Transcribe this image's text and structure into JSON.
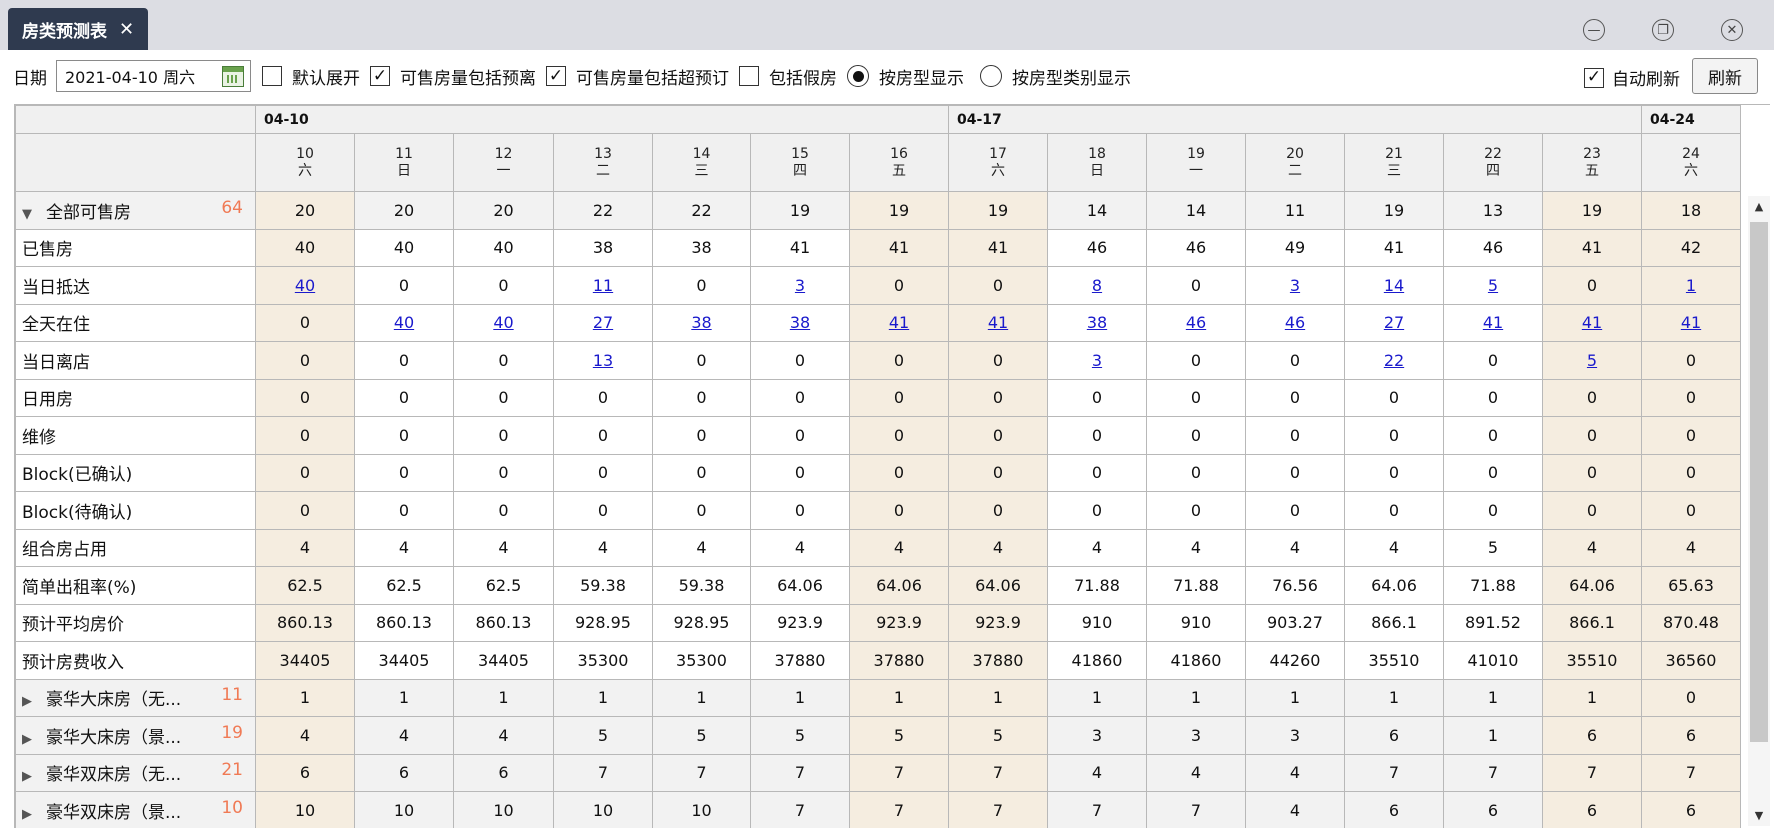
{
  "window": {
    "tab_title": "房类预测表"
  },
  "toolbar": {
    "date_label": "日期",
    "date_value": "2021-04-10 周六",
    "opt_expand": "默认展开",
    "opt_include_preblock": "可售房量包括预离",
    "opt_include_overbook": "可售房量包括超预订",
    "opt_include_fake": "包括假房",
    "radio_by_type": "按房型显示",
    "radio_by_category": "按房型类别显示",
    "auto_refresh": "自动刷新",
    "refresh": "刷新"
  },
  "grid": {
    "week_labels": [
      "04-10",
      "04-17",
      "04-24"
    ],
    "days": [
      {
        "d": "10",
        "w": "六"
      },
      {
        "d": "11",
        "w": "日"
      },
      {
        "d": "12",
        "w": "一"
      },
      {
        "d": "13",
        "w": "二"
      },
      {
        "d": "14",
        "w": "三"
      },
      {
        "d": "15",
        "w": "四"
      },
      {
        "d": "16",
        "w": "五"
      },
      {
        "d": "17",
        "w": "六"
      },
      {
        "d": "18",
        "w": "日"
      },
      {
        "d": "19",
        "w": "一"
      },
      {
        "d": "20",
        "w": "二"
      },
      {
        "d": "21",
        "w": "三"
      },
      {
        "d": "22",
        "w": "四"
      },
      {
        "d": "23",
        "w": "五"
      },
      {
        "d": "24",
        "w": "六"
      }
    ],
    "rows": [
      {
        "name": "全部可售房",
        "count": "64",
        "group": "expanded",
        "values": [
          "20",
          "20",
          "20",
          "22",
          "22",
          "19",
          "19",
          "19",
          "14",
          "14",
          "11",
          "19",
          "13",
          "19",
          "18"
        ]
      },
      {
        "name": "已售房",
        "values": [
          "40",
          "40",
          "40",
          "38",
          "38",
          "41",
          "41",
          "41",
          "46",
          "46",
          "49",
          "41",
          "46",
          "41",
          "42"
        ]
      },
      {
        "name": "当日抵达",
        "links": [
          0,
          3,
          5,
          8,
          10,
          11,
          12,
          14
        ],
        "values": [
          "40",
          "0",
          "0",
          "11",
          "0",
          "3",
          "0",
          "0",
          "8",
          "0",
          "3",
          "14",
          "5",
          "0",
          "1"
        ]
      },
      {
        "name": "全天在住",
        "links": [
          1,
          2,
          3,
          4,
          5,
          6,
          7,
          8,
          9,
          10,
          11,
          12,
          13,
          14
        ],
        "values": [
          "0",
          "40",
          "40",
          "27",
          "38",
          "38",
          "41",
          "41",
          "38",
          "46",
          "46",
          "27",
          "41",
          "41",
          "41"
        ]
      },
      {
        "name": "当日离店",
        "links": [
          3,
          8,
          11,
          13
        ],
        "values": [
          "0",
          "0",
          "0",
          "13",
          "0",
          "0",
          "0",
          "0",
          "3",
          "0",
          "0",
          "22",
          "0",
          "5",
          "0"
        ]
      },
      {
        "name": "日用房",
        "values": [
          "0",
          "0",
          "0",
          "0",
          "0",
          "0",
          "0",
          "0",
          "0",
          "0",
          "0",
          "0",
          "0",
          "0",
          "0"
        ]
      },
      {
        "name": "维修",
        "values": [
          "0",
          "0",
          "0",
          "0",
          "0",
          "0",
          "0",
          "0",
          "0",
          "0",
          "0",
          "0",
          "0",
          "0",
          "0"
        ]
      },
      {
        "name": "Block(已确认)",
        "values": [
          "0",
          "0",
          "0",
          "0",
          "0",
          "0",
          "0",
          "0",
          "0",
          "0",
          "0",
          "0",
          "0",
          "0",
          "0"
        ]
      },
      {
        "name": "Block(待确认)",
        "values": [
          "0",
          "0",
          "0",
          "0",
          "0",
          "0",
          "0",
          "0",
          "0",
          "0",
          "0",
          "0",
          "0",
          "0",
          "0"
        ]
      },
      {
        "name": "组合房占用",
        "values": [
          "4",
          "4",
          "4",
          "4",
          "4",
          "4",
          "4",
          "4",
          "4",
          "4",
          "4",
          "4",
          "5",
          "4",
          "4"
        ]
      },
      {
        "name": "简单出租率(%)",
        "values": [
          "62.5",
          "62.5",
          "62.5",
          "59.38",
          "59.38",
          "64.06",
          "64.06",
          "64.06",
          "71.88",
          "71.88",
          "76.56",
          "64.06",
          "71.88",
          "64.06",
          "65.63"
        ]
      },
      {
        "name": "预计平均房价",
        "values": [
          "860.13",
          "860.13",
          "860.13",
          "928.95",
          "928.95",
          "923.9",
          "923.9",
          "923.9",
          "910",
          "910",
          "903.27",
          "866.1",
          "891.52",
          "866.1",
          "870.48"
        ]
      },
      {
        "name": "预计房费收入",
        "values": [
          "34405",
          "34405",
          "34405",
          "35300",
          "35300",
          "37880",
          "37880",
          "37880",
          "41860",
          "41860",
          "44260",
          "35510",
          "41010",
          "35510",
          "36560"
        ]
      },
      {
        "name": "豪华大床房（无...",
        "count": "11",
        "group": "collapsed",
        "values": [
          "1",
          "1",
          "1",
          "1",
          "1",
          "1",
          "1",
          "1",
          "1",
          "1",
          "1",
          "1",
          "1",
          "1",
          "0"
        ]
      },
      {
        "name": "豪华大床房（景...",
        "count": "19",
        "group": "collapsed",
        "values": [
          "4",
          "4",
          "4",
          "5",
          "5",
          "5",
          "5",
          "5",
          "3",
          "3",
          "3",
          "6",
          "1",
          "6",
          "6"
        ]
      },
      {
        "name": "豪华双床房（无...",
        "count": "21",
        "group": "collapsed",
        "values": [
          "6",
          "6",
          "6",
          "7",
          "7",
          "7",
          "7",
          "7",
          "4",
          "4",
          "4",
          "7",
          "7",
          "7",
          "7"
        ]
      },
      {
        "name": "豪华双床房（景...",
        "count": "10",
        "group": "collapsed",
        "values": [
          "10",
          "10",
          "10",
          "10",
          "10",
          "7",
          "7",
          "7",
          "7",
          "7",
          "4",
          "6",
          "6",
          "6",
          "6"
        ]
      }
    ]
  }
}
